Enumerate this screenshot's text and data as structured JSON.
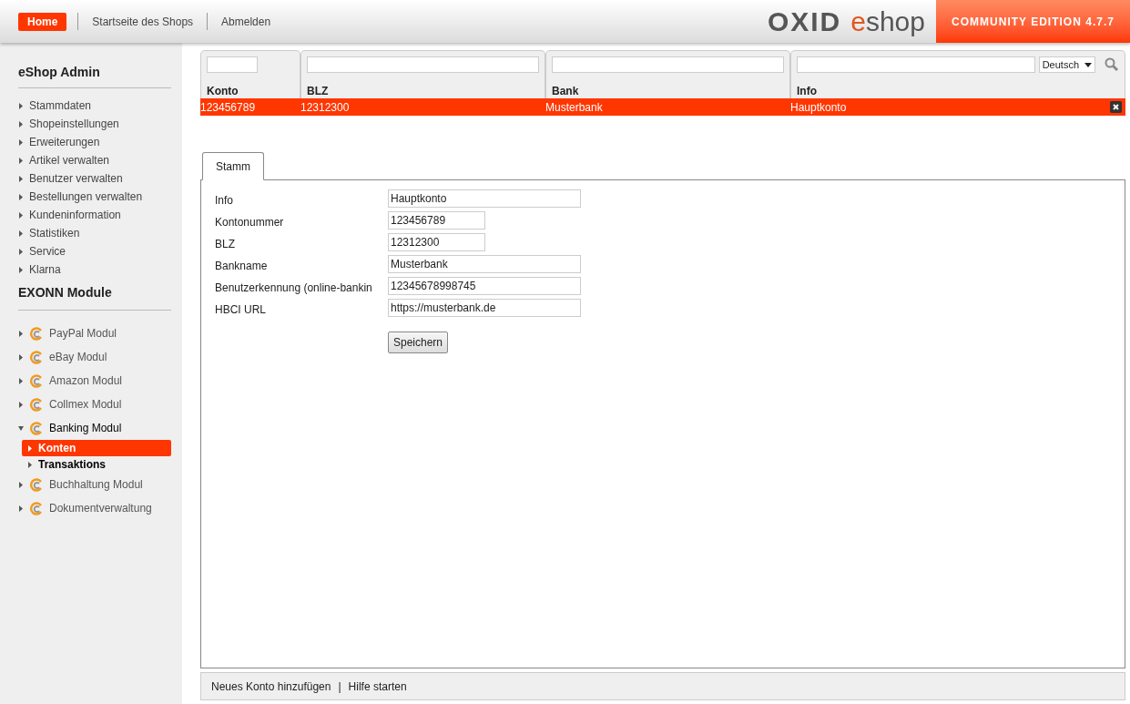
{
  "header": {
    "nav": [
      {
        "label": "Home",
        "selected": true
      },
      {
        "label": "Startseite des Shops",
        "selected": false
      },
      {
        "label": "Abmelden",
        "selected": false
      }
    ],
    "logo": {
      "brand": "OXID",
      "accent": "e",
      "product": "shop"
    },
    "edition": "COMMUNITY EDITION 4.7.7"
  },
  "sidebar": {
    "title": "eShop Admin",
    "items": [
      "Stammdaten",
      "Shopeinstellungen",
      "Erweiterungen",
      "Artikel verwalten",
      "Benutzer verwalten",
      "Bestellungen verwalten",
      "Kundeninformation",
      "Statistiken",
      "Service",
      "Klarna"
    ],
    "modules_title": "EXONN Module",
    "modules": [
      {
        "label": "PayPal Modul",
        "expanded": false
      },
      {
        "label": "eBay Modul",
        "expanded": false
      },
      {
        "label": "Amazon Modul",
        "expanded": false
      },
      {
        "label": "Collmex Modul",
        "expanded": false
      },
      {
        "label": "Banking Modul",
        "expanded": true,
        "children": [
          {
            "label": "Konten",
            "selected": true
          },
          {
            "label": "Transaktions",
            "selected": false
          }
        ]
      },
      {
        "label": "Buchhaltung Modul",
        "expanded": false
      },
      {
        "label": "Dokumentverwaltung",
        "expanded": false
      }
    ]
  },
  "table": {
    "columns": [
      "Konto",
      "BLZ",
      "Bank",
      "Info"
    ],
    "language": "Deutsch",
    "rows": [
      {
        "cells": [
          "123456789",
          "12312300",
          "Musterbank",
          "Hauptkonto"
        ],
        "selected": true
      }
    ]
  },
  "tabs": [
    {
      "label": "Stamm",
      "selected": true
    }
  ],
  "form": {
    "fields": [
      {
        "label": "Info",
        "value": "Hauptkonto",
        "kind": "wide"
      },
      {
        "label": "Kontonummer",
        "value": "123456789",
        "kind": "short"
      },
      {
        "label": "BLZ",
        "value": "12312300",
        "kind": "short"
      },
      {
        "label": "Bankname",
        "value": "Musterbank",
        "kind": "wide"
      },
      {
        "label": "Benutzerkennung (online-bankin",
        "value": "12345678998745",
        "kind": "wide"
      },
      {
        "label": "HBCI URL",
        "value": "https://musterbank.de",
        "kind": "wide"
      }
    ],
    "submit": "Speichern"
  },
  "footer": {
    "links": [
      "Neues Konto hinzufügen",
      "Hilfe starten"
    ],
    "separator": "|"
  }
}
